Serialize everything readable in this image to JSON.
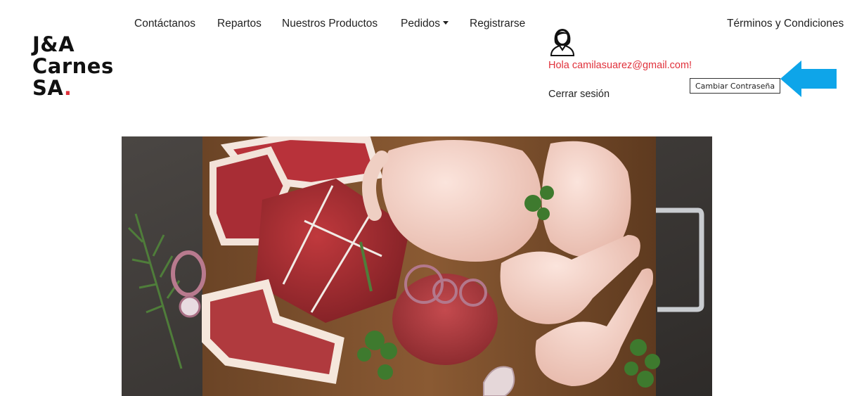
{
  "brand": {
    "line1": "J&A",
    "line2": "Carnes",
    "line3": "SA",
    "dot": "."
  },
  "nav": {
    "contact": "Contáctanos",
    "deliveries": "Repartos",
    "products": "Nuestros Productos",
    "orders": "Pedidos",
    "register": "Registrarse"
  },
  "terms": "Términos y Condiciones",
  "user": {
    "greeting": "Hola camilasuarez@gmail.com!",
    "logout": "Cerrar sesión",
    "change_password": "Cambiar Contraseña",
    "avatar_icon": "user-female-icon"
  },
  "annotation": {
    "icon": "arrow-left-icon",
    "color": "#0ea5e9"
  },
  "hero": {
    "image": "raw-meat-board-photo"
  },
  "colors": {
    "accent": "#e0313b",
    "text": "#222222"
  }
}
